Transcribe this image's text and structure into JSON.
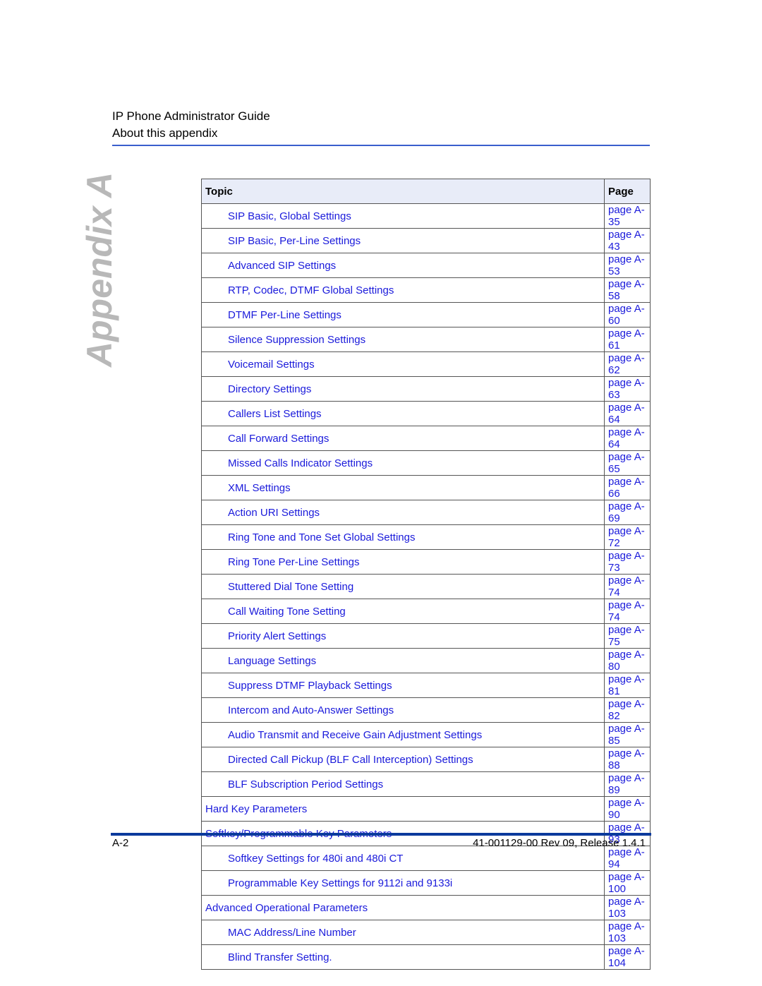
{
  "header": {
    "title": "IP Phone Administrator Guide",
    "subtitle": "About this appendix"
  },
  "side_title": "Appendix A",
  "table": {
    "headers": {
      "topic": "Topic",
      "page": "Page"
    },
    "rows": [
      {
        "topic": "SIP Basic, Global Settings",
        "page": "page A-35",
        "level": 2
      },
      {
        "topic": "SIP Basic, Per-Line Settings",
        "page": "page A-43",
        "level": 2
      },
      {
        "topic": "Advanced SIP Settings",
        "page": "page A-53",
        "level": 2
      },
      {
        "topic": "RTP, Codec, DTMF Global Settings",
        "page": "page A-58",
        "level": 2
      },
      {
        "topic": "DTMF Per-Line Settings",
        "page": "page A-60",
        "level": 2
      },
      {
        "topic": "Silence Suppression Settings",
        "page": "page A-61",
        "level": 2
      },
      {
        "topic": "Voicemail Settings",
        "page": "page A-62",
        "level": 2
      },
      {
        "topic": "Directory Settings",
        "page": "page A-63",
        "level": 2
      },
      {
        "topic": "Callers List Settings",
        "page": "page A-64",
        "level": 2
      },
      {
        "topic": "Call Forward Settings",
        "page": "page A-64",
        "level": 2
      },
      {
        "topic": "Missed Calls Indicator Settings",
        "page": "page A-65",
        "level": 2
      },
      {
        "topic": "XML Settings",
        "page": "page A-66",
        "level": 2
      },
      {
        "topic": "Action URI Settings",
        "page": "page A-69",
        "level": 2
      },
      {
        "topic": "Ring Tone and Tone Set Global Settings",
        "page": "page A-72",
        "level": 2
      },
      {
        "topic": "Ring Tone Per-Line Settings",
        "page": "page A-73",
        "level": 2
      },
      {
        "topic": "Stuttered Dial Tone Setting",
        "page": "page A-74",
        "level": 2
      },
      {
        "topic": "Call Waiting Tone Setting",
        "page": "page A-74",
        "level": 2
      },
      {
        "topic": "Priority Alert Settings",
        "page": "page A-75",
        "level": 2
      },
      {
        "topic": "Language Settings",
        "page": "page A-80",
        "level": 2
      },
      {
        "topic": "Suppress DTMF Playback Settings",
        "page": "page A-81",
        "level": 2
      },
      {
        "topic": "Intercom and Auto-Answer Settings",
        "page": "page A-82",
        "level": 2
      },
      {
        "topic": "Audio Transmit and Receive Gain Adjustment Settings",
        "page": "page A-85",
        "level": 2
      },
      {
        "topic": "Directed Call Pickup (BLF Call Interception) Settings",
        "page": "page A-88",
        "level": 2
      },
      {
        "topic": "BLF Subscription Period Settings",
        "page": "page A-89",
        "level": 2
      },
      {
        "topic": "Hard Key Parameters",
        "page": "page A-90",
        "level": 1
      },
      {
        "topic": "Softkey/Programmable Key Parameters",
        "page": "page A-93",
        "level": 1
      },
      {
        "topic": "Softkey Settings for 480i and 480i CT",
        "page": "page A-94",
        "level": 2
      },
      {
        "topic": "Programmable Key Settings for 9112i and 9133i",
        "page": "page A-100",
        "level": 2
      },
      {
        "topic": "Advanced Operational Parameters",
        "page": "page A-103",
        "level": 1
      },
      {
        "topic": "MAC Address/Line Number",
        "page": "page A-103",
        "level": 2
      },
      {
        "topic": "Blind Transfer Setting.",
        "page": "page A-104",
        "level": 2
      }
    ]
  },
  "footer": {
    "page_number": "A-2",
    "doc_id": "41-001129-00 Rev 09, Release 1.4.1"
  },
  "colors": {
    "link": "#1a1adb",
    "header_rule": "#3a5fcd",
    "footer_rule": "#0b3a9c",
    "table_header_bg": "#e8ecf8",
    "side_title": "#b8b8b8"
  }
}
